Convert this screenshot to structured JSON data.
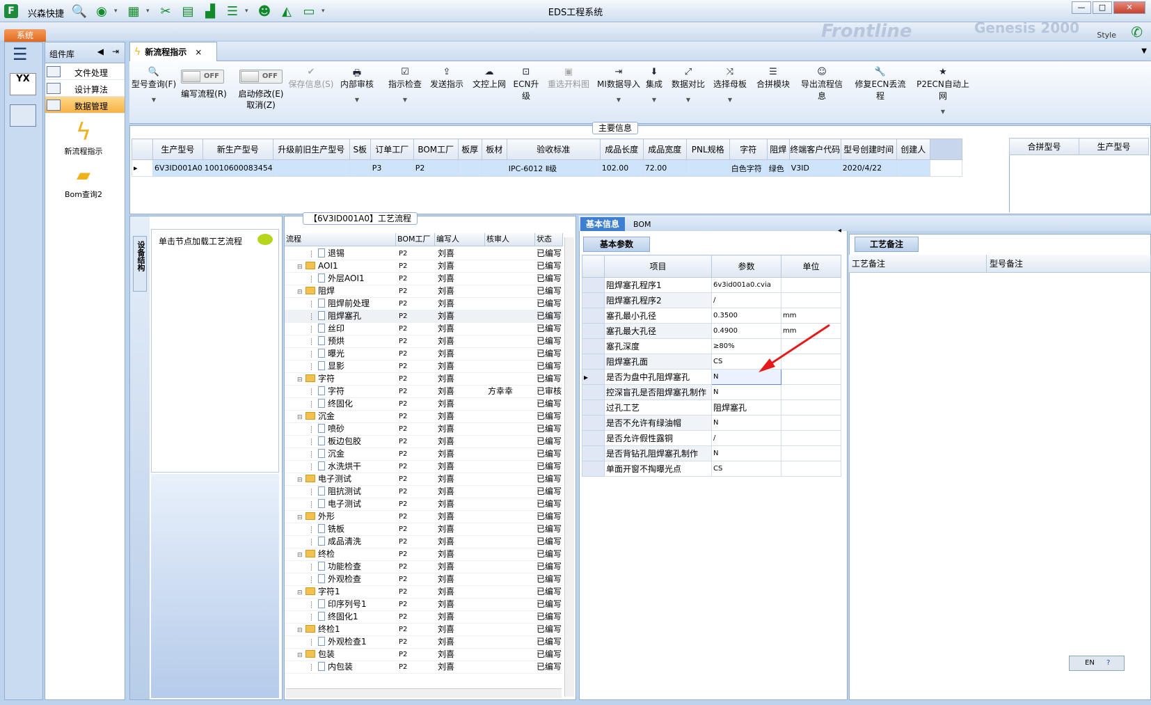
{
  "titlebar": {
    "app_name": "兴森快捷",
    "window_title": "EDS工程系统",
    "min": "—",
    "max": "□",
    "close": "✕"
  },
  "quick_icons": [
    "search-icon",
    "globe-icon",
    "grid-icon",
    "scissors-icon",
    "film-icon",
    "chart-icon",
    "list-icon",
    "user-icon",
    "area-chart-icon",
    "monitor-icon"
  ],
  "menu": {
    "system_tab": "系统",
    "style_label": "Style",
    "ghost_brand": "Frontline",
    "ghost_genesis": "Genesis 2000"
  },
  "components": {
    "title": "组件库",
    "items": [
      {
        "label": "文件处理"
      },
      {
        "label": "设计算法"
      },
      {
        "label": "数据管理"
      }
    ],
    "tools": [
      {
        "label": "新流程指示",
        "icon": "lightning-icon"
      },
      {
        "label": "Bom查询2",
        "icon": "folder-icon"
      }
    ]
  },
  "doc_tab": {
    "title": "新流程指示",
    "close": "×"
  },
  "ribbon": {
    "type_query": "型号查询(F)",
    "write_flow": "编写流程(R)",
    "start_modify": "启动修改(E)",
    "cancel": "取消(Z)",
    "toggle_off": "OFF",
    "buttons": [
      {
        "label": "保存信息(S)",
        "icon": "✔",
        "disabled": true
      },
      {
        "label": "内部审核",
        "icon": "🖶",
        "disabled": false,
        "dd": true
      },
      {
        "label": "指示检查",
        "icon": "☑",
        "disabled": false,
        "dd": true
      },
      {
        "label": "发送指示",
        "icon": "⇪",
        "disabled": false,
        "dd": false
      },
      {
        "label": "文控上网",
        "icon": "☁",
        "disabled": false,
        "dd": false
      },
      {
        "label": "ECN升级",
        "icon": "⊡",
        "disabled": false,
        "dd": false
      },
      {
        "label": "重选开料图",
        "icon": "▣",
        "disabled": true,
        "dd": false
      },
      {
        "label": "MI数据导入",
        "icon": "⇥",
        "disabled": false,
        "dd": true
      },
      {
        "label": "集成",
        "icon": "⬇",
        "disabled": false,
        "dd": true
      },
      {
        "label": "数据对比",
        "icon": "⤢",
        "disabled": false,
        "dd": true
      },
      {
        "label": "选择母板",
        "icon": "⤨",
        "disabled": false,
        "dd": true
      },
      {
        "label": "合拼模块",
        "icon": "☰",
        "disabled": false,
        "dd": false
      },
      {
        "label": "导出流程信息",
        "icon": "☺",
        "disabled": false,
        "dd": false
      },
      {
        "label": "修复ECN丢流程",
        "icon": "🔧",
        "disabled": false,
        "dd": false
      },
      {
        "label": "P2ECN自动上网",
        "icon": "★",
        "disabled": false,
        "dd": true
      }
    ]
  },
  "main_info": {
    "title": "主要信息",
    "columns": [
      "生产型号",
      "新生产型号",
      "升级前旧生产型号",
      "S板",
      "订单工厂",
      "BOM工厂",
      "板厚",
      "板材",
      "验收标准",
      "成品长度",
      "成品宽度",
      "PNL规格",
      "字符",
      "阻焊",
      "终端客户代码",
      "型号创建时间",
      "创建人"
    ],
    "rows": [
      [
        "6V3ID001A0",
        "10010600083454",
        "",
        "",
        "P3",
        "P2",
        "",
        "",
        "IPC-6012 Ⅱ级",
        "102.00",
        "72.00",
        "",
        "白色字符",
        "绿色",
        "V3ID",
        "2020/4/22",
        ""
      ]
    ],
    "merge_columns": [
      "合拼型号",
      "生产型号"
    ]
  },
  "structure": {
    "side_label": "设备结构",
    "hint": "单击节点加载工艺流程",
    "flow_title": "【6V3ID001A0】工艺流程",
    "headers": [
      "流程",
      "BOM工厂",
      "编写人",
      "核审人",
      "状态"
    ],
    "rows": [
      {
        "level": 2,
        "kind": "doc",
        "name": "退锡",
        "bom": "P2",
        "writer": "刘喜",
        "reviewer": "",
        "status": "已编写"
      },
      {
        "level": 1,
        "kind": "folder",
        "name": "AOI1",
        "bom": "P2",
        "writer": "刘喜",
        "reviewer": "",
        "status": "已编写"
      },
      {
        "level": 2,
        "kind": "doc",
        "name": "外层AOI1",
        "bom": "P2",
        "writer": "刘喜",
        "reviewer": "",
        "status": "已编写"
      },
      {
        "level": 1,
        "kind": "folder",
        "name": "阻焊",
        "bom": "P2",
        "writer": "刘喜",
        "reviewer": "",
        "status": "已编写"
      },
      {
        "level": 2,
        "kind": "doc",
        "name": "阻焊前处理",
        "bom": "P2",
        "writer": "刘喜",
        "reviewer": "",
        "status": "已编写"
      },
      {
        "level": 2,
        "kind": "doc",
        "name": "阻焊塞孔",
        "bom": "P2",
        "writer": "刘喜",
        "reviewer": "",
        "status": "已编写",
        "hl": true
      },
      {
        "level": 2,
        "kind": "doc",
        "name": "丝印",
        "bom": "P2",
        "writer": "刘喜",
        "reviewer": "",
        "status": "已编写"
      },
      {
        "level": 2,
        "kind": "doc",
        "name": "预烘",
        "bom": "P2",
        "writer": "刘喜",
        "reviewer": "",
        "status": "已编写"
      },
      {
        "level": 2,
        "kind": "doc",
        "name": "曝光",
        "bom": "P2",
        "writer": "刘喜",
        "reviewer": "",
        "status": "已编写"
      },
      {
        "level": 2,
        "kind": "doc",
        "name": "显影",
        "bom": "P2",
        "writer": "刘喜",
        "reviewer": "",
        "status": "已编写"
      },
      {
        "level": 1,
        "kind": "folder",
        "name": "字符",
        "bom": "P2",
        "writer": "刘喜",
        "reviewer": "",
        "status": "已编写"
      },
      {
        "level": 2,
        "kind": "doc",
        "name": "字符",
        "bom": "P2",
        "writer": "刘喜",
        "reviewer": "方幸幸",
        "status": "已审核"
      },
      {
        "level": 2,
        "kind": "doc",
        "name": "终固化",
        "bom": "P2",
        "writer": "刘喜",
        "reviewer": "",
        "status": "已编写"
      },
      {
        "level": 1,
        "kind": "folder",
        "name": "沉金",
        "bom": "P2",
        "writer": "刘喜",
        "reviewer": "",
        "status": "已编写"
      },
      {
        "level": 2,
        "kind": "doc",
        "name": "喷砂",
        "bom": "P2",
        "writer": "刘喜",
        "reviewer": "",
        "status": "已编写"
      },
      {
        "level": 2,
        "kind": "doc",
        "name": "板边包胶",
        "bom": "P2",
        "writer": "刘喜",
        "reviewer": "",
        "status": "已编写"
      },
      {
        "level": 2,
        "kind": "doc",
        "name": "沉金",
        "bom": "P2",
        "writer": "刘喜",
        "reviewer": "",
        "status": "已编写"
      },
      {
        "level": 2,
        "kind": "doc",
        "name": "水洗烘干",
        "bom": "P2",
        "writer": "刘喜",
        "reviewer": "",
        "status": "已编写"
      },
      {
        "level": 1,
        "kind": "folder",
        "name": "电子测试",
        "bom": "P2",
        "writer": "刘喜",
        "reviewer": "",
        "status": "已编写"
      },
      {
        "level": 2,
        "kind": "doc",
        "name": "阻抗测试",
        "bom": "P2",
        "writer": "刘喜",
        "reviewer": "",
        "status": "已编写"
      },
      {
        "level": 2,
        "kind": "doc",
        "name": "电子测试",
        "bom": "P2",
        "writer": "刘喜",
        "reviewer": "",
        "status": "已编写"
      },
      {
        "level": 1,
        "kind": "folder",
        "name": "外形",
        "bom": "P2",
        "writer": "刘喜",
        "reviewer": "",
        "status": "已编写"
      },
      {
        "level": 2,
        "kind": "doc",
        "name": "铣板",
        "bom": "P2",
        "writer": "刘喜",
        "reviewer": "",
        "status": "已编写"
      },
      {
        "level": 2,
        "kind": "doc",
        "name": "成品清洗",
        "bom": "P2",
        "writer": "刘喜",
        "reviewer": "",
        "status": "已编写"
      },
      {
        "level": 1,
        "kind": "folder",
        "name": "终检",
        "bom": "P2",
        "writer": "刘喜",
        "reviewer": "",
        "status": "已编写"
      },
      {
        "level": 2,
        "kind": "doc",
        "name": "功能检查",
        "bom": "P2",
        "writer": "刘喜",
        "reviewer": "",
        "status": "已编写"
      },
      {
        "level": 2,
        "kind": "doc",
        "name": "外观检查",
        "bom": "P2",
        "writer": "刘喜",
        "reviewer": "",
        "status": "已编写"
      },
      {
        "level": 1,
        "kind": "folder",
        "name": "字符1",
        "bom": "P2",
        "writer": "刘喜",
        "reviewer": "",
        "status": "已编写"
      },
      {
        "level": 2,
        "kind": "doc",
        "name": "印序列号1",
        "bom": "P2",
        "writer": "刘喜",
        "reviewer": "",
        "status": "已编写"
      },
      {
        "level": 2,
        "kind": "doc",
        "name": "终固化1",
        "bom": "P2",
        "writer": "刘喜",
        "reviewer": "",
        "status": "已编写"
      },
      {
        "level": 1,
        "kind": "folder",
        "name": "终检1",
        "bom": "P2",
        "writer": "刘喜",
        "reviewer": "",
        "status": "已编写"
      },
      {
        "level": 2,
        "kind": "doc",
        "name": "外观检查1",
        "bom": "P2",
        "writer": "刘喜",
        "reviewer": "",
        "status": "已编写"
      },
      {
        "level": 1,
        "kind": "folder",
        "name": "包装",
        "bom": "P2",
        "writer": "刘喜",
        "reviewer": "",
        "status": "已编写"
      },
      {
        "level": 2,
        "kind": "doc",
        "name": "内包装",
        "bom": "P2",
        "writer": "刘喜",
        "reviewer": "",
        "status": "已编写"
      }
    ]
  },
  "params": {
    "tabs": [
      "基本信息",
      "BOM"
    ],
    "subtab": "基本参数",
    "headers": [
      "项目",
      "参数",
      "单位"
    ],
    "rows": [
      {
        "item": "阻焊塞孔程序1",
        "value": "6v3id001a0.cvia",
        "unit": ""
      },
      {
        "item": "阻焊塞孔程序2",
        "value": "/",
        "unit": ""
      },
      {
        "item": "塞孔最小孔径",
        "value": "0.3500",
        "unit": "mm"
      },
      {
        "item": "塞孔最大孔径",
        "value": "0.4900",
        "unit": "mm"
      },
      {
        "item": "塞孔深度",
        "value": "≥80%",
        "unit": ""
      },
      {
        "item": "阻焊塞孔面",
        "value": "CS",
        "unit": ""
      },
      {
        "item": "是否为盘中孔阻焊塞孔",
        "value": "N",
        "unit": "",
        "selected": true
      },
      {
        "item": "控深盲孔是否阻焊塞孔制作",
        "value": "N",
        "unit": ""
      },
      {
        "item": "过孔工艺",
        "value": "阻焊塞孔",
        "unit": ""
      },
      {
        "item": "是否不允许有绿油帽",
        "value": "N",
        "unit": ""
      },
      {
        "item": "是否允许假性露铜",
        "value": "/",
        "unit": ""
      },
      {
        "item": "是否背钻孔阻焊塞孔制作",
        "value": "N",
        "unit": ""
      },
      {
        "item": "单面开窗不掏曝光点",
        "value": "CS",
        "unit": ""
      }
    ]
  },
  "notes": {
    "tab": "工艺备注",
    "headers": [
      "工艺备注",
      "型号备注"
    ]
  },
  "ime": {
    "label": "EN"
  }
}
